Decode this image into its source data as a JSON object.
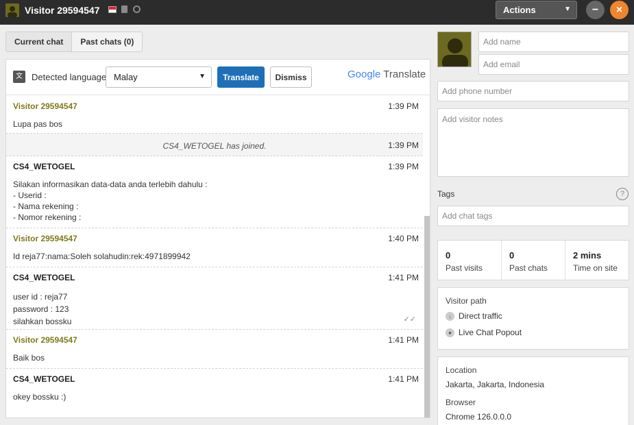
{
  "header": {
    "title": "Visitor 29594547",
    "actions_label": "Actions",
    "minimize_glyph": "−",
    "close_glyph": "×"
  },
  "tabs": [
    {
      "label": "Current chat"
    },
    {
      "label": "Past chats (0)"
    }
  ],
  "translate": {
    "label": "Detected language",
    "language": "Malay",
    "translate_label": "Translate",
    "dismiss_label": "Dismiss",
    "brand_google": "Google",
    "brand_translate": "Translate"
  },
  "messages": [
    {
      "name": "Visitor 29594547",
      "time": "1:39 PM",
      "text": "Lupa pas bos"
    },
    {
      "system": "CS4_WETOGEL has joined.",
      "time": "1:39 PM"
    },
    {
      "name": "CS4_WETOGEL",
      "time": "1:39 PM",
      "text": "Silakan informasikan data-data anda terlebih dahulu :\n- Userid :\n- Nama rekening :\n- Nomor rekening :"
    },
    {
      "name": "Visitor 29594547",
      "time": "1:40 PM",
      "text": "Id reja77:nama:Soleh solahudin:rek:4971899942"
    },
    {
      "name": "CS4_WETOGEL",
      "time": "1:41 PM",
      "text": "user id : reja77\npassword : 123\nsilahkan bossku"
    },
    {
      "name": "Visitor 29594547",
      "time": "1:41 PM",
      "text": "Baik bos"
    },
    {
      "name": "CS4_WETOGEL",
      "time": "1:41 PM",
      "text": "okey bossku :)"
    }
  ],
  "visitor": {
    "name_placeholder": "Add name",
    "email_placeholder": "Add email",
    "phone_placeholder": "Add phone number",
    "notes_placeholder": "Add visitor notes",
    "tags_label": "Tags",
    "tags_placeholder": "Add chat tags",
    "stats": [
      {
        "value": "0",
        "label": "Past visits"
      },
      {
        "value": "0",
        "label": "Past chats"
      },
      {
        "value": "2 mins",
        "label": "Time on site"
      }
    ],
    "path_title": "Visitor path",
    "path": [
      "Direct traffic",
      "Live Chat Popout"
    ],
    "location_label": "Location",
    "location": "Jakarta, Jakarta, Indonesia",
    "browser_label": "Browser",
    "browser": "Chrome 126.0.0.0"
  },
  "colors": {
    "visitor_name": "#7f7a1a",
    "translate_button": "#1e6fb8",
    "close_button": "#f0852d"
  }
}
